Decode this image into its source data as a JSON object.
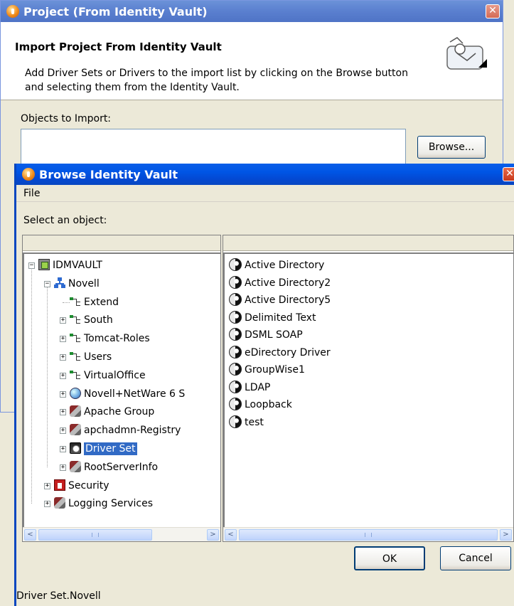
{
  "back_dialog": {
    "title": "Project (From Identity Vault)",
    "banner_title": "Import Project From Identity Vault",
    "banner_desc": "Add Driver Sets or Drivers to the import list by clicking on the Browse button and selecting them from the Identity Vault.",
    "objects_label": "Objects to Import:",
    "browse_label": "Browse...",
    "close_glyph": "✕"
  },
  "browse_dialog": {
    "title": "Browse Identity Vault",
    "menu": [
      "File"
    ],
    "select_label": "Select an object:",
    "tree": [
      {
        "label": "IDMVAULT",
        "icon": "server-icon",
        "expander": "−"
      },
      {
        "label": "Novell",
        "icon": "organization-icon",
        "expander": "−"
      },
      {
        "label": "Extend",
        "icon": "org-unit-icon",
        "expander": ""
      },
      {
        "label": "South",
        "icon": "org-unit-icon",
        "expander": "+"
      },
      {
        "label": "Tomcat-Roles",
        "icon": "org-unit-icon",
        "expander": "+"
      },
      {
        "label": "Users",
        "icon": "org-unit-icon",
        "expander": "+"
      },
      {
        "label": "VirtualOffice",
        "icon": "org-unit-icon",
        "expander": "+"
      },
      {
        "label": "Novell+NetWare 6 S",
        "icon": "globe-icon",
        "expander": "+"
      },
      {
        "label": "Apache Group",
        "icon": "tool-icon",
        "expander": "+"
      },
      {
        "label": "apchadmn-Registry",
        "icon": "tool-icon",
        "expander": "+"
      },
      {
        "label": "Driver Set",
        "icon": "driver-set-icon",
        "expander": "+",
        "selected": true
      },
      {
        "label": "RootServerInfo",
        "icon": "tool-icon",
        "expander": "+"
      },
      {
        "label": "Security",
        "icon": "security-icon",
        "expander": "+"
      },
      {
        "label": "Logging Services",
        "icon": "tool-icon",
        "expander": "+"
      }
    ],
    "drivers": [
      "Active Directory",
      "Active Directory2",
      "Active Directory5",
      "Delimited Text",
      "DSML SOAP",
      "eDirectory Driver",
      "GroupWise1",
      "LDAP",
      "Loopback",
      "test"
    ],
    "ok_label": "OK",
    "cancel_label": "Cancel",
    "status": "Driver Set.Novell",
    "close_glyph": "✕"
  },
  "scroll": {
    "left": "<",
    "right": ">"
  }
}
